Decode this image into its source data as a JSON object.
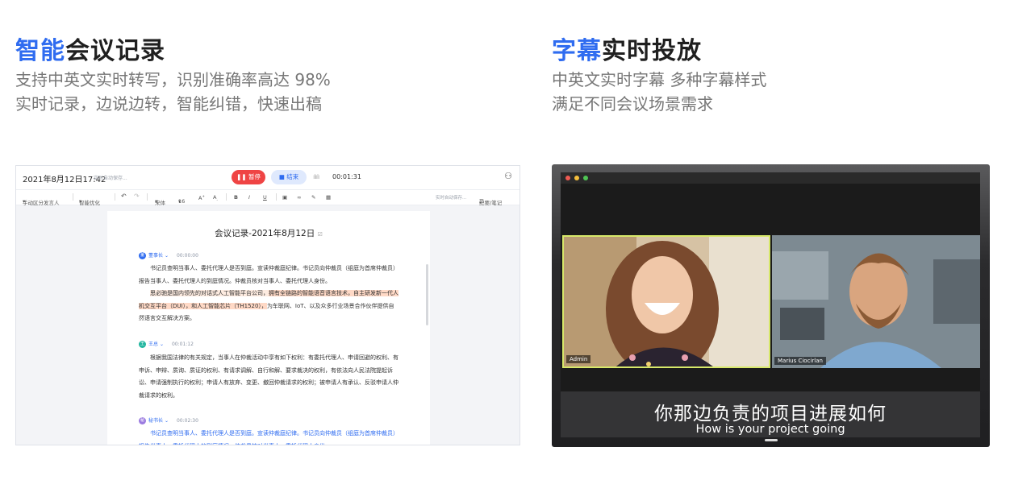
{
  "features": {
    "meeting": {
      "title_accent": "智能",
      "title_rest": "会议记录",
      "desc_lines": [
        "支持中英文实时转写，识别准确率高达 98%",
        "实时记录，边说边转，智能纠错，快速出稿"
      ]
    },
    "subtitle": {
      "title_accent": "字幕",
      "title_rest": "实时投放",
      "desc_lines": [
        "中英文实时字幕 多种字幕样式",
        "满足不同会议场景需求"
      ]
    }
  },
  "editor": {
    "datetime": "2021年8月12日17:42",
    "autosave": "实时自动保存...",
    "pause_label": "暂停",
    "end_label": "结束",
    "timer": "00:01:31",
    "toolbar": {
      "speaker_mode": "手动区分发言人",
      "smart_optimize": "智能优化",
      "font": "宋体",
      "size": "16",
      "autosave": "实时自动保存...",
      "minutes": "纪要/笔记"
    },
    "doc_title": "会议记录-2021年8月12日",
    "blocks": [
      {
        "speaker": "董事长",
        "avatar": "董",
        "avatar_color": "#2f6cf0",
        "time": "00:00:00",
        "p1": "书记员查明当事人、委托代理人是否到庭。宣读仲裁庭纪律。书记员向仲裁员（组庭为首席仲裁员）报告当事人、委托代理人的到庭情况。仲裁员核对当事人、委托代理人身份。",
        "p2_start": "思必驰是国内领先的对话式人工智能平台公司，",
        "p2_highlight": "拥有全链路的智能语音语言技术，自主研发新一代人机交互平台（DUI），和人工智能芯片（TH1520），",
        "p2_end": "为车联网、IoT、以及众多行业场景合作伙伴提供自然语言交互解决方案。"
      },
      {
        "speaker": "王总",
        "avatar": "王",
        "avatar_color": "#23b6a0",
        "time": "00:01:12",
        "p1": "根据我国法律的有关规定，当事人在仲裁活动中享有如下权利：有委托代理人、申请回避的权利、有申诉、申辩、质询、质证的权利、有请求调解、自行和解、要求裁决的权利，有依法向人民法院提起诉讼、申请强制执行的权利；申请人有放弃、变更、撤回仲裁请求的权利；被申请人有承认、反驳申请人仲裁请求的权利。"
      },
      {
        "speaker": "秘书长",
        "avatar": "秘",
        "avatar_color": "#9b7be0",
        "time": "00:02:30",
        "p1": "书记员查明当事人、委托代理人是否到庭。宣读仲裁庭纪律。书记员向仲裁员（组庭为首席仲裁员）报告当事人、委托代理人的到庭情况。仲裁员核对当事人、委托代理人身份。"
      }
    ]
  },
  "screen": {
    "participants": [
      {
        "name": "Admin"
      },
      {
        "name": "Marius Ciocirlan"
      }
    ],
    "subtitle_cn": "你那边负责的项目进展如何",
    "subtitle_en": "How is your project going"
  }
}
